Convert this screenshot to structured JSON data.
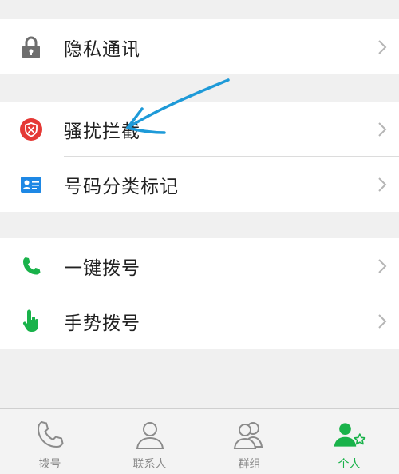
{
  "groups": [
    {
      "items": [
        {
          "label": "隐私通讯",
          "icon": "lock-icon"
        }
      ]
    },
    {
      "items": [
        {
          "label": "骚扰拦截",
          "icon": "shield-block-icon"
        },
        {
          "label": "号码分类标记",
          "icon": "id-card-icon"
        }
      ]
    },
    {
      "items": [
        {
          "label": "一键拨号",
          "icon": "phone-icon"
        },
        {
          "label": "手势拨号",
          "icon": "hand-pointer-icon"
        }
      ]
    }
  ],
  "tabs": [
    {
      "label": "拨号",
      "icon": "phone-outline-icon",
      "active": false
    },
    {
      "label": "联系人",
      "icon": "person-icon",
      "active": false
    },
    {
      "label": "群组",
      "icon": "group-icon",
      "active": false
    },
    {
      "label": "个人",
      "icon": "person-star-icon",
      "active": true
    }
  ],
  "colors": {
    "accent": "#19b24a",
    "shield": "#e53935",
    "card": "#1e88e5",
    "annotation": "#1e9ad8"
  }
}
